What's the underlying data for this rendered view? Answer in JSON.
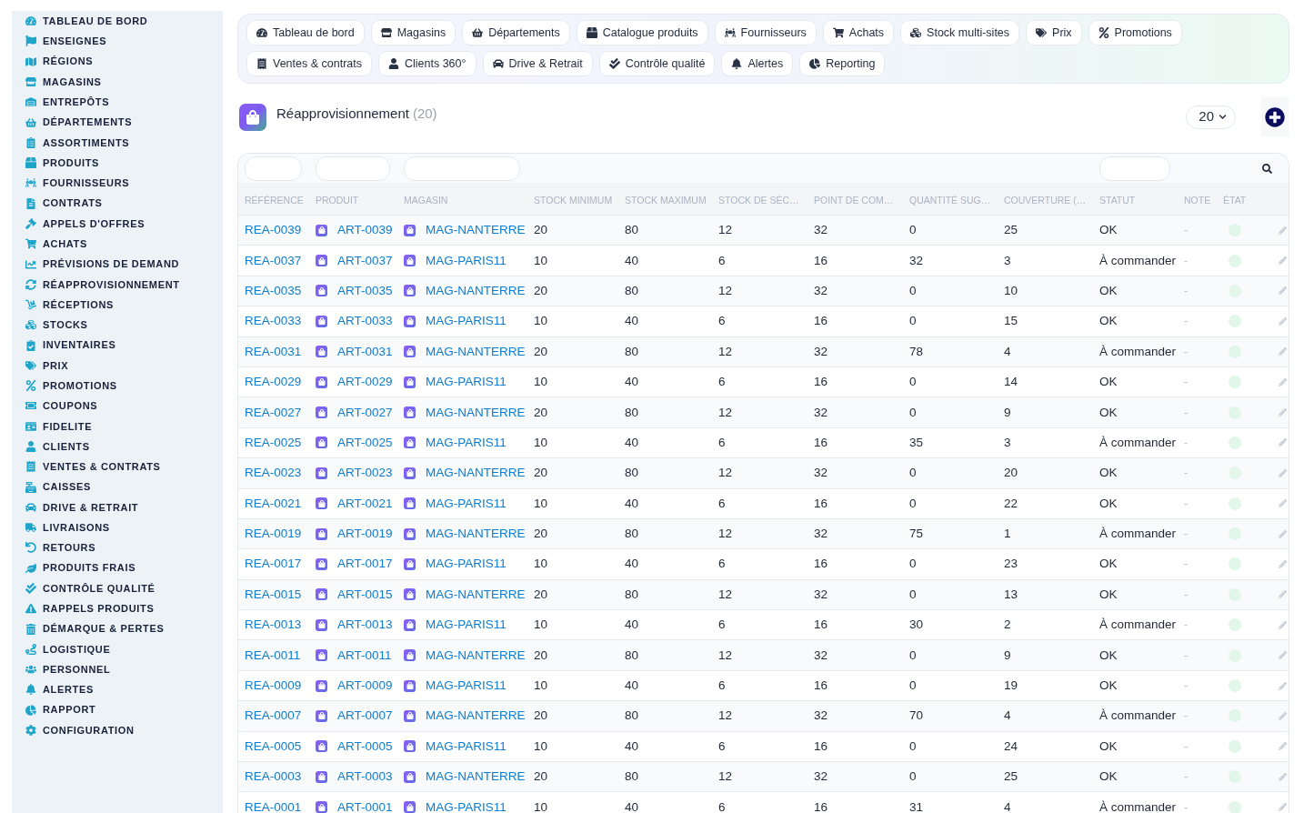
{
  "sidebar": {
    "items": [
      "TABLEAU DE BORD",
      "ENSEIGNES",
      "RÉGIONS",
      "MAGASINS",
      "ENTREPÔTS",
      "DÉPARTEMENTS",
      "ASSORTIMENTS",
      "PRODUITS",
      "FOURNISSEURS",
      "CONTRATS",
      "APPELS D'OFFRES",
      "ACHATS",
      "PRÉVISIONS DE DEMAND",
      "RÉAPPROVISIONNEMENT",
      "RÉCEPTIONS",
      "STOCKS",
      "INVENTAIRES",
      "PRIX",
      "PROMOTIONS",
      "COUPONS",
      "FIDELITE",
      "CLIENTS",
      "VENTES & CONTRATS",
      "CAISSES",
      "DRIVE & RETRAIT",
      "LIVRAISONS",
      "RETOURS",
      "PRODUITS FRAIS",
      "CONTRÔLE QUALITÉ",
      "RAPPELS PRODUITS",
      "DÉMARQUE & PERTES",
      "LOGISTIQUE",
      "PERSONNEL",
      "ALERTES",
      "RAPPORT",
      "CONFIGURATION"
    ]
  },
  "top_nav": {
    "rows": [
      {
        "buttons": [
          "Tableau de bord",
          "Magasins",
          "Départements",
          "Catalogue produits",
          "Fournisseurs",
          "Achats",
          "Stock multi-sites",
          "Prix",
          "Promotions"
        ]
      },
      {
        "buttons": [
          "Ventes & contrats",
          "Clients 360°",
          "Drive & Retrait",
          "Contrôle qualité",
          "Alertes",
          "Reporting"
        ]
      }
    ]
  },
  "page_header": {
    "title": "Réapprovisionnement",
    "count": "(20)",
    "page_size": "20"
  },
  "table": {
    "columns": [
      {
        "label": "RÉFÉRENCE",
        "kind": "link",
        "filter": true
      },
      {
        "label": "PRODUIT",
        "kind": "icon_link",
        "filter": true
      },
      {
        "label": "MAGASIN",
        "kind": "icon_link",
        "filter": true
      },
      {
        "label": "STOCK MINIMUM",
        "kind": "text",
        "filter": false
      },
      {
        "label": "STOCK MAXIMUM",
        "kind": "text",
        "filter": false
      },
      {
        "label": "STOCK DE SÉC…",
        "kind": "text",
        "filter": false
      },
      {
        "label": "POINT DE COM…",
        "kind": "text",
        "filter": false
      },
      {
        "label": "QUANTITÉ SUG…",
        "kind": "text",
        "filter": false
      },
      {
        "label": "COUVERTURE (…",
        "kind": "text",
        "filter": false
      },
      {
        "label": "STATUT",
        "kind": "text",
        "filter": true
      },
      {
        "label": "NOTE",
        "kind": "muted",
        "filter": false
      },
      {
        "label": "ÉTAT",
        "kind": "dot",
        "filter": false
      }
    ],
    "rows": [
      {
        "cells": [
          "REA-0039",
          "ART-0039",
          "MAG-NANTERRE",
          "20",
          "80",
          "12",
          "32",
          "0",
          "25",
          "OK",
          "-"
        ]
      },
      {
        "cells": [
          "REA-0037",
          "ART-0037",
          "MAG-PARIS11",
          "10",
          "40",
          "6",
          "16",
          "32",
          "3",
          "À commander",
          "-"
        ]
      },
      {
        "cells": [
          "REA-0035",
          "ART-0035",
          "MAG-NANTERRE",
          "20",
          "80",
          "12",
          "32",
          "0",
          "10",
          "OK",
          "-"
        ]
      },
      {
        "cells": [
          "REA-0033",
          "ART-0033",
          "MAG-PARIS11",
          "10",
          "40",
          "6",
          "16",
          "0",
          "15",
          "OK",
          "-"
        ]
      },
      {
        "cells": [
          "REA-0031",
          "ART-0031",
          "MAG-NANTERRE",
          "20",
          "80",
          "12",
          "32",
          "78",
          "4",
          "À commander",
          "-"
        ]
      },
      {
        "cells": [
          "REA-0029",
          "ART-0029",
          "MAG-PARIS11",
          "10",
          "40",
          "6",
          "16",
          "0",
          "14",
          "OK",
          "-"
        ]
      },
      {
        "cells": [
          "REA-0027",
          "ART-0027",
          "MAG-NANTERRE",
          "20",
          "80",
          "12",
          "32",
          "0",
          "9",
          "OK",
          "-"
        ]
      },
      {
        "cells": [
          "REA-0025",
          "ART-0025",
          "MAG-PARIS11",
          "10",
          "40",
          "6",
          "16",
          "35",
          "3",
          "À commander",
          "-"
        ]
      },
      {
        "cells": [
          "REA-0023",
          "ART-0023",
          "MAG-NANTERRE",
          "20",
          "80",
          "12",
          "32",
          "0",
          "20",
          "OK",
          "-"
        ]
      },
      {
        "cells": [
          "REA-0021",
          "ART-0021",
          "MAG-PARIS11",
          "10",
          "40",
          "6",
          "16",
          "0",
          "22",
          "OK",
          "-"
        ]
      },
      {
        "cells": [
          "REA-0019",
          "ART-0019",
          "MAG-NANTERRE",
          "20",
          "80",
          "12",
          "32",
          "75",
          "1",
          "À commander",
          "-"
        ]
      },
      {
        "cells": [
          "REA-0017",
          "ART-0017",
          "MAG-PARIS11",
          "10",
          "40",
          "6",
          "16",
          "0",
          "23",
          "OK",
          "-"
        ]
      },
      {
        "cells": [
          "REA-0015",
          "ART-0015",
          "MAG-NANTERRE",
          "20",
          "80",
          "12",
          "32",
          "0",
          "13",
          "OK",
          "-"
        ]
      },
      {
        "cells": [
          "REA-0013",
          "ART-0013",
          "MAG-PARIS11",
          "10",
          "40",
          "6",
          "16",
          "30",
          "2",
          "À commander",
          "-"
        ]
      },
      {
        "cells": [
          "REA-0011",
          "ART-0011",
          "MAG-NANTERRE",
          "20",
          "80",
          "12",
          "32",
          "0",
          "9",
          "OK",
          "-"
        ]
      },
      {
        "cells": [
          "REA-0009",
          "ART-0009",
          "MAG-PARIS11",
          "10",
          "40",
          "6",
          "16",
          "0",
          "19",
          "OK",
          "-"
        ]
      },
      {
        "cells": [
          "REA-0007",
          "ART-0007",
          "MAG-NANTERRE",
          "20",
          "80",
          "12",
          "32",
          "70",
          "4",
          "À commander",
          "-"
        ]
      },
      {
        "cells": [
          "REA-0005",
          "ART-0005",
          "MAG-PARIS11",
          "10",
          "40",
          "6",
          "16",
          "0",
          "24",
          "OK",
          "-"
        ]
      },
      {
        "cells": [
          "REA-0003",
          "ART-0003",
          "MAG-NANTERRE",
          "20",
          "80",
          "12",
          "32",
          "0",
          "25",
          "OK",
          "-"
        ]
      },
      {
        "cells": [
          "REA-0001",
          "ART-0001",
          "MAG-PARIS11",
          "10",
          "40",
          "6",
          "16",
          "31",
          "4",
          "À commander",
          "-"
        ]
      }
    ]
  }
}
